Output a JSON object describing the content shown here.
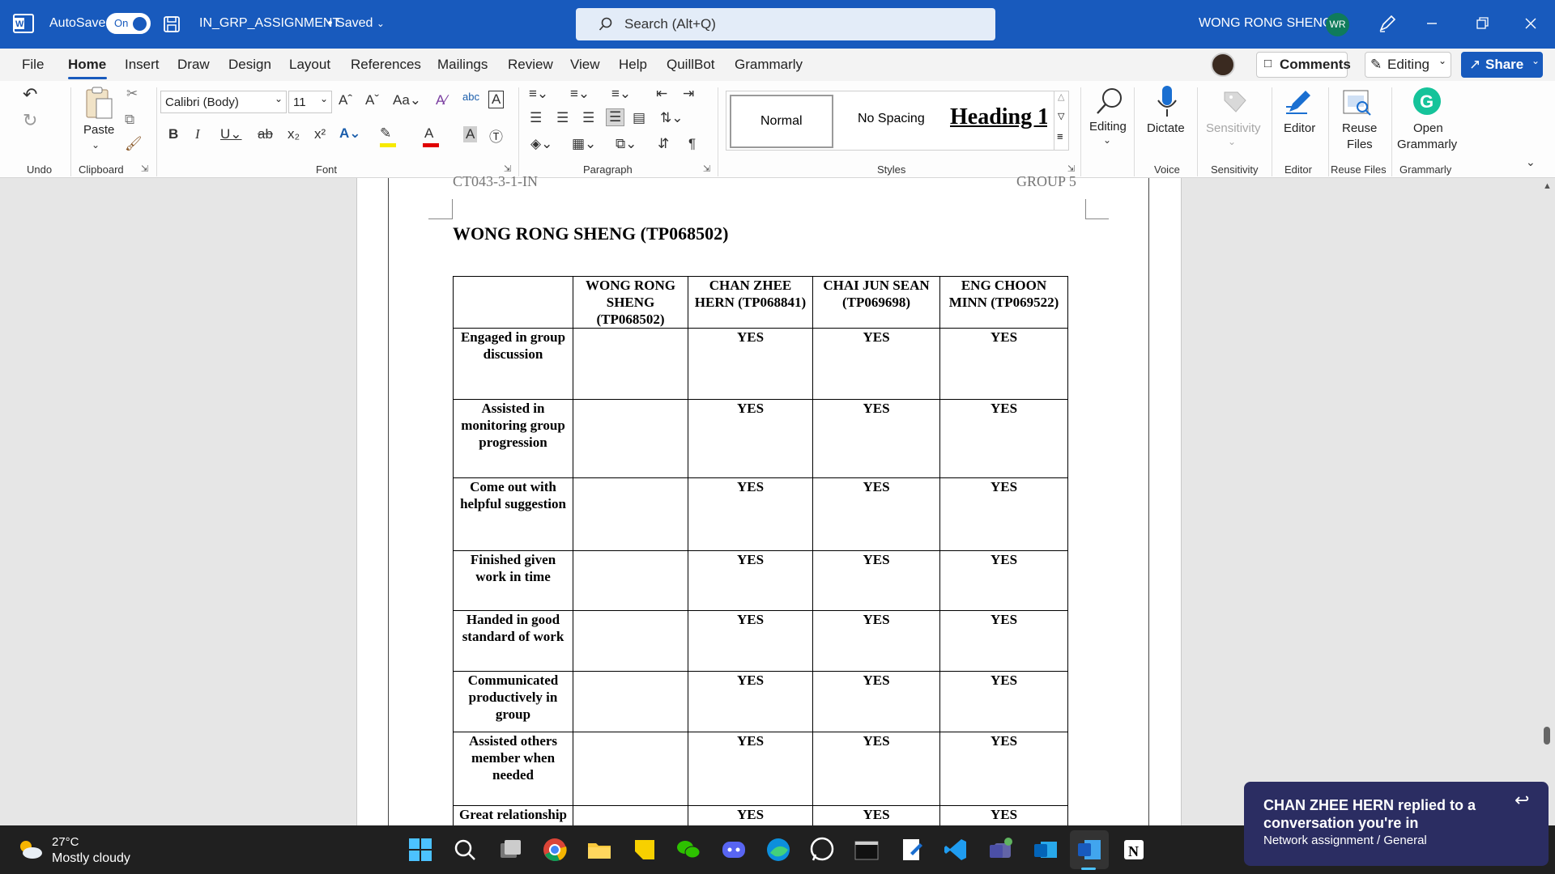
{
  "titlebar": {
    "autosave_label": "AutoSave",
    "toggle_label": "On",
    "doc_name": "IN_GRP_ASSIGNMENT",
    "saved_label": "• Saved",
    "search_placeholder": "Search (Alt+Q)",
    "user_name": "WONG RONG SHENG",
    "user_initials": "WR",
    "brand_color": "#185abd"
  },
  "menu": {
    "tabs": [
      "File",
      "Home",
      "Insert",
      "Draw",
      "Design",
      "Layout",
      "References",
      "Mailings",
      "Review",
      "View",
      "Help",
      "QuillBot",
      "Grammarly"
    ],
    "active_tab": "Home",
    "comments_label": "Comments",
    "editing_label": "Editing",
    "share_label": "Share"
  },
  "ribbon": {
    "font_name": "Calibri (Body)",
    "font_size": "11",
    "paste_label": "Paste",
    "styles": {
      "normal": "Normal",
      "no_spacing": "No Spacing",
      "heading": "Heading 1"
    },
    "editing_label": "Editing",
    "dictate_label": "Dictate",
    "sensitivity_label": "Sensitivity",
    "editor_label": "Editor",
    "reuse_files_label": "Reuse\nFiles",
    "reuse_line1": "Reuse",
    "reuse_line2": "Files",
    "open_grammarly_line1": "Open",
    "open_grammarly_line2": "Grammarly",
    "groups": {
      "undo": "Undo",
      "clipboard": "Clipboard",
      "font": "Font",
      "paragraph": "Paragraph",
      "styles": "Styles",
      "voice": "Voice",
      "sensitivity": "Sensitivity",
      "editor": "Editor",
      "reuse_files": "Reuse Files",
      "grammarly": "Grammarly"
    }
  },
  "document": {
    "header_left": "CT043-3-1-IN",
    "header_right": "GROUP 5",
    "title": "WONG RONG SHENG (TP068502)",
    "table": {
      "columns": [
        "WONG RONG SHENG (TP068502)",
        "CHAN ZHEE HERN (TP068841)",
        "CHAI JUN SEAN (TP069698)",
        "ENG CHOON MINN (TP069522)"
      ],
      "rows": [
        {
          "criterion": "Engaged in group discussion",
          "values": [
            "",
            "YES",
            "YES",
            "YES"
          ]
        },
        {
          "criterion": "Assisted in monitoring group progression",
          "values": [
            "",
            "YES",
            "YES",
            "YES"
          ]
        },
        {
          "criterion": "Come out with helpful suggestion",
          "values": [
            "",
            "YES",
            "YES",
            "YES"
          ]
        },
        {
          "criterion": "Finished given work in time",
          "values": [
            "",
            "YES",
            "YES",
            "YES"
          ]
        },
        {
          "criterion": "Handed in good standard of work",
          "values": [
            "",
            "YES",
            "YES",
            "YES"
          ]
        },
        {
          "criterion": "Communicated productively in group",
          "values": [
            "",
            "YES",
            "YES",
            "YES"
          ]
        },
        {
          "criterion": "Assisted others member when needed",
          "values": [
            "",
            "YES",
            "YES",
            "YES"
          ]
        },
        {
          "criterion": "Great relationship",
          "values": [
            "",
            "YES",
            "YES",
            "YES"
          ]
        }
      ]
    }
  },
  "taskbar": {
    "weather_temp": "27°C",
    "weather_desc": "Mostly cloudy",
    "apps": [
      "start-icon",
      "search-icon",
      "task-view-icon",
      "chrome-icon",
      "file-explorer-icon",
      "sticky-notes-icon",
      "wechat-icon",
      "discord-icon",
      "edge-icon",
      "whatsapp-icon",
      "terminal-icon",
      "notepad-icon",
      "vscode-icon",
      "teams-icon",
      "outlook-icon",
      "word-icon",
      "notion-icon"
    ]
  },
  "toast": {
    "title": "CHAN ZHEE HERN replied to a conversation you're in",
    "subtitle": "Network assignment / General"
  }
}
